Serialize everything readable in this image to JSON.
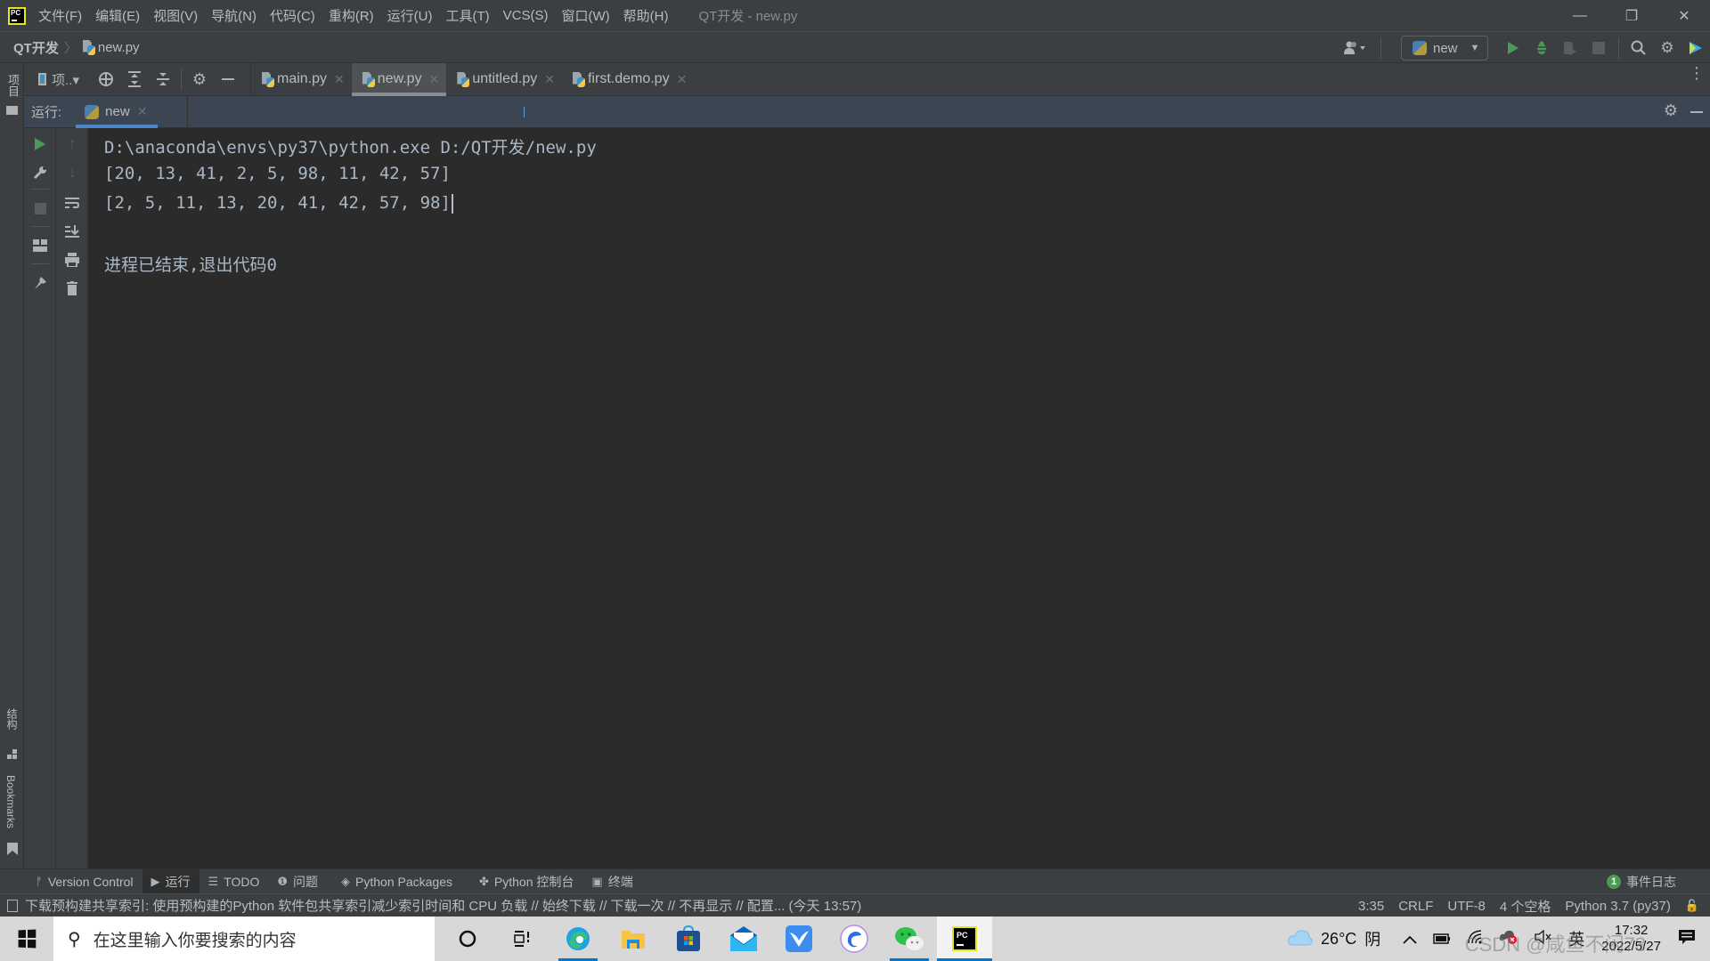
{
  "titlebar": {
    "menu": [
      "文件(F)",
      "编辑(E)",
      "视图(V)",
      "导航(N)",
      "代码(C)",
      "重构(R)",
      "运行(U)",
      "工具(T)",
      "VCS(S)",
      "窗口(W)",
      "帮助(H)"
    ],
    "window_title": "QT开发 - new.py",
    "minimize": "—",
    "restore": "❐",
    "close": "✕"
  },
  "navbar": {
    "project": "QT开发",
    "separator": "〉",
    "file": "new.py",
    "run_config": "new"
  },
  "left_stripe": {
    "project": "项目",
    "structure": "结构",
    "bookmarks": "Bookmarks"
  },
  "editor_toolbar": {
    "project_view_label": "项..▾"
  },
  "tabs": [
    {
      "label": "main.py",
      "active": false
    },
    {
      "label": "new.py",
      "active": true
    },
    {
      "label": "untitled.py",
      "active": false
    },
    {
      "label": "first.demo.py",
      "active": false
    }
  ],
  "run_window": {
    "label": "运行:",
    "tab": "new"
  },
  "console": {
    "lines": [
      "D:\\anaconda\\envs\\py37\\python.exe D:/QT开发/new.py",
      "[20, 13, 41, 2, 5, 98, 11, 42, 57]",
      "[2, 5, 11, 13, 20, 41, 42, 57, 98]",
      "",
      "进程已结束,退出代码0"
    ]
  },
  "bottom_tools": [
    {
      "label": "Version Control",
      "icon": "branch-icon"
    },
    {
      "label": "运行",
      "icon": "run-icon",
      "active": true
    },
    {
      "label": "TODO",
      "icon": "list-icon"
    },
    {
      "label": "问题",
      "icon": "problems-icon"
    },
    {
      "label": "Python Packages",
      "icon": "packages-icon"
    },
    {
      "label": "Python 控制台",
      "icon": "python-console-icon"
    },
    {
      "label": "终端",
      "icon": "terminal-icon"
    }
  ],
  "event_log": {
    "count": "1",
    "label": "事件日志"
  },
  "statusbar": {
    "message": "下载预构建共享索引: 使用预构建的Python 软件包共享索引减少索引时间和 CPU 负载 // 始终下载 // 下载一次 // 不再显示 // 配置... (今天 13:57)",
    "position": "3:35",
    "line_ending": "CRLF",
    "encoding": "UTF-8",
    "indent": "4 个空格",
    "interpreter": "Python 3.7 (py37)"
  },
  "taskbar": {
    "search_placeholder": "在这里输入你要搜索的内容",
    "weather_temp": "26°C",
    "weather_desc": "阴",
    "ime": "英",
    "time": "17:32",
    "date": "2022/5/27",
    "watermark": "CSDN @咸鱼不闲73"
  },
  "colors": {
    "accent_blue": "#4a88c7",
    "run_green": "#499c54",
    "ide_bg": "#2b2b2b",
    "panel_bg": "#3c3f41"
  }
}
